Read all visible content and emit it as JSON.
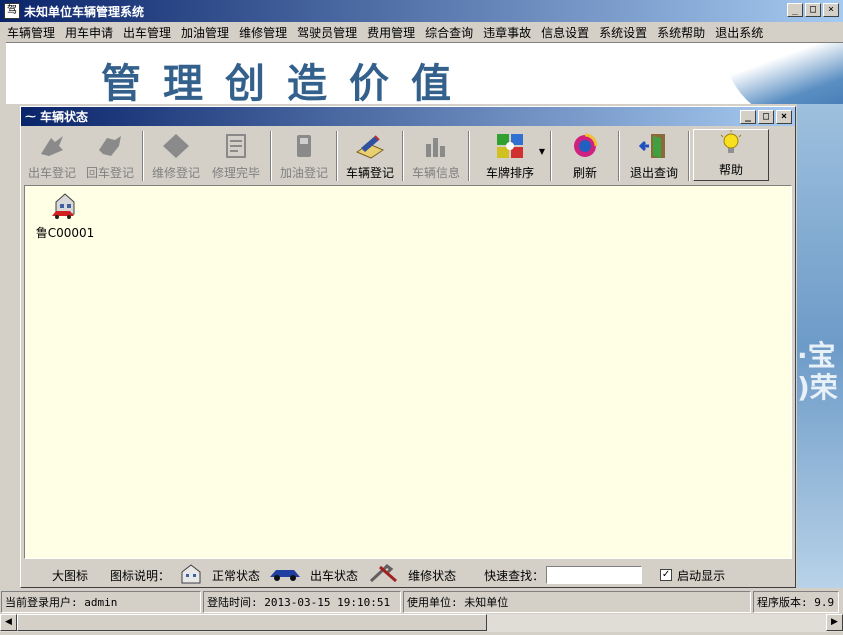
{
  "window": {
    "title": "未知单位车辆管理系统",
    "buttons": [
      "_",
      "□",
      "×"
    ]
  },
  "menu": [
    "车辆管理",
    "用车申请",
    "出车管理",
    "加油管理",
    "维修管理",
    "驾驶员管理",
    "费用管理",
    "综合查询",
    "违章事故",
    "信息设置",
    "系统设置",
    "系统帮助",
    "退出系统"
  ],
  "banner": {
    "slogan": "管理创造价值"
  },
  "child_window": {
    "title": "车辆状态",
    "buttons": [
      "_",
      "□",
      "×"
    ]
  },
  "toolbar": [
    {
      "label": "出车登记",
      "icon": "car-out-icon",
      "enabled": false
    },
    {
      "label": "回车登记",
      "icon": "car-return-icon",
      "enabled": false
    },
    {
      "label": "维修登记",
      "icon": "repair-icon",
      "enabled": false
    },
    {
      "label": "修理完毕",
      "icon": "repair-done-icon",
      "enabled": false
    },
    {
      "label": "加油登记",
      "icon": "fuel-pump-icon",
      "enabled": false
    },
    {
      "label": "车辆登记",
      "icon": "register-book-icon",
      "enabled": true
    },
    {
      "label": "车辆信息",
      "icon": "vehicle-info-icon",
      "enabled": false
    },
    {
      "label": "车牌排序",
      "icon": "sort-icon",
      "enabled": true
    },
    {
      "label": "刷新",
      "icon": "refresh-icon",
      "enabled": true
    },
    {
      "label": "退出查询",
      "icon": "exit-door-icon",
      "enabled": true
    },
    {
      "label": "帮助",
      "icon": "lightbulb-icon",
      "enabled": true
    }
  ],
  "vehicles": [
    {
      "plate": "鲁C00001",
      "status": "normal"
    }
  ],
  "legend": {
    "view_mode": "大图标",
    "legend_label": "图标说明：",
    "normal": "正常状态",
    "out": "出车状态",
    "repair": "维修状态",
    "search_label": "快速查找：",
    "search_value": "",
    "autostart_label": "启动显示",
    "autostart_checked": "✓"
  },
  "statusbar": {
    "user": "当前登录用户: admin",
    "login_time": "登陆时间: 2013-03-15 19:10:51",
    "org": "使用单位: 未知单位",
    "version": "程序版本: 9.9"
  }
}
